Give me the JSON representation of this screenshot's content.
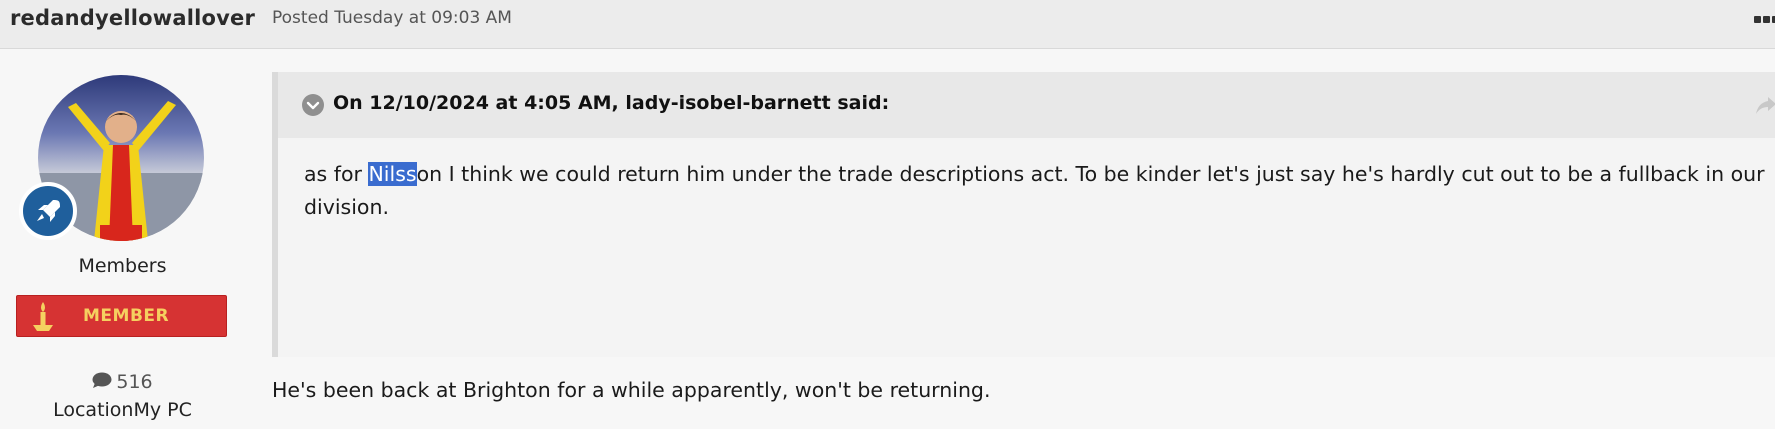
{
  "post": {
    "author": "redandyellowallover",
    "posted": "Posted Tuesday at 09:03 AM"
  },
  "author_panel": {
    "group": "Members",
    "badge_label": "MEMBER",
    "post_count": "516",
    "location": "LocationMy PC"
  },
  "quote": {
    "citation": "On 12/10/2024 at 4:05 AM, lady-isobel-barnett said:",
    "line1_before": "as for ",
    "line1_selected": "Nilss",
    "line1_after": "on I think we could return him under the trade descriptions act. To be kinder let's just say he's hardly cut out to be a fullback in our",
    "line2": "division."
  },
  "reply_text": "He's been back at Brighton for a while apparently, won't be returning.",
  "icons": {
    "menu": "ellipsis-icon",
    "rank": "rocket-icon",
    "group_emblem": "candle-emblem-icon",
    "posts": "speech-bubble-icon",
    "quote_toggle": "chevron-down-icon",
    "quote_share": "share-arrow-icon"
  },
  "colors": {
    "member_badge": "#d63333",
    "member_text": "#f5d060",
    "rank_badge": "#1f5f9c",
    "selection": "#3a6ccf"
  }
}
